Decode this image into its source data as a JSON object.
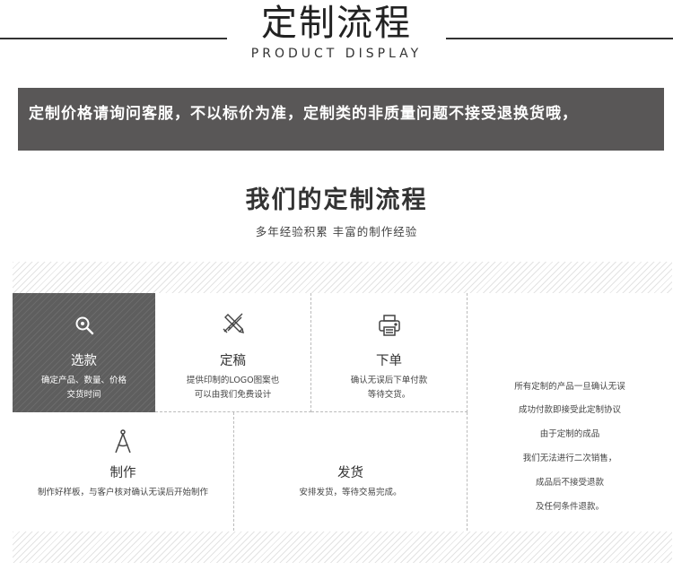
{
  "header": {
    "title": "定制流程",
    "subtitle": "PRODUCT DISPLAY"
  },
  "notice": {
    "text": "定制价格请询问客服，不以标价为准，定制类的非质量问题不接受退换货哦，"
  },
  "section": {
    "heading": "我们的定制流程",
    "subheading": "多年经验积累 丰富的制作经验"
  },
  "steps": [
    {
      "title": "选款",
      "desc_line1": "确定产品、数量、价格",
      "desc_line2": "交货时间",
      "icon": "search-icon"
    },
    {
      "title": "定稿",
      "desc_line1": "提供印制的LOGO图案也",
      "desc_line2": "可以由我们免费设计",
      "icon": "design-tools-icon"
    },
    {
      "title": "下单",
      "desc_line1": "确认无误后下单付款",
      "desc_line2": "等待交货。",
      "icon": "printer-icon"
    },
    {
      "title": "制作",
      "desc_line1": "制作好样板，与客户核对确认无误后开始制作",
      "icon": "compass-icon"
    },
    {
      "title": "发货",
      "desc_line1": "安排发货，等待交易完成。"
    }
  ],
  "policy": [
    "所有定制的产品一旦确认无误",
    "成功付款即接受此定制协议",
    "由于定制的成品",
    "我们无法进行二次销售，",
    "成品后不接受退款",
    "及任何条件退款。"
  ],
  "colors": {
    "notice_bg": "#595757",
    "dark_cell": "#666666",
    "text": "#333333"
  }
}
